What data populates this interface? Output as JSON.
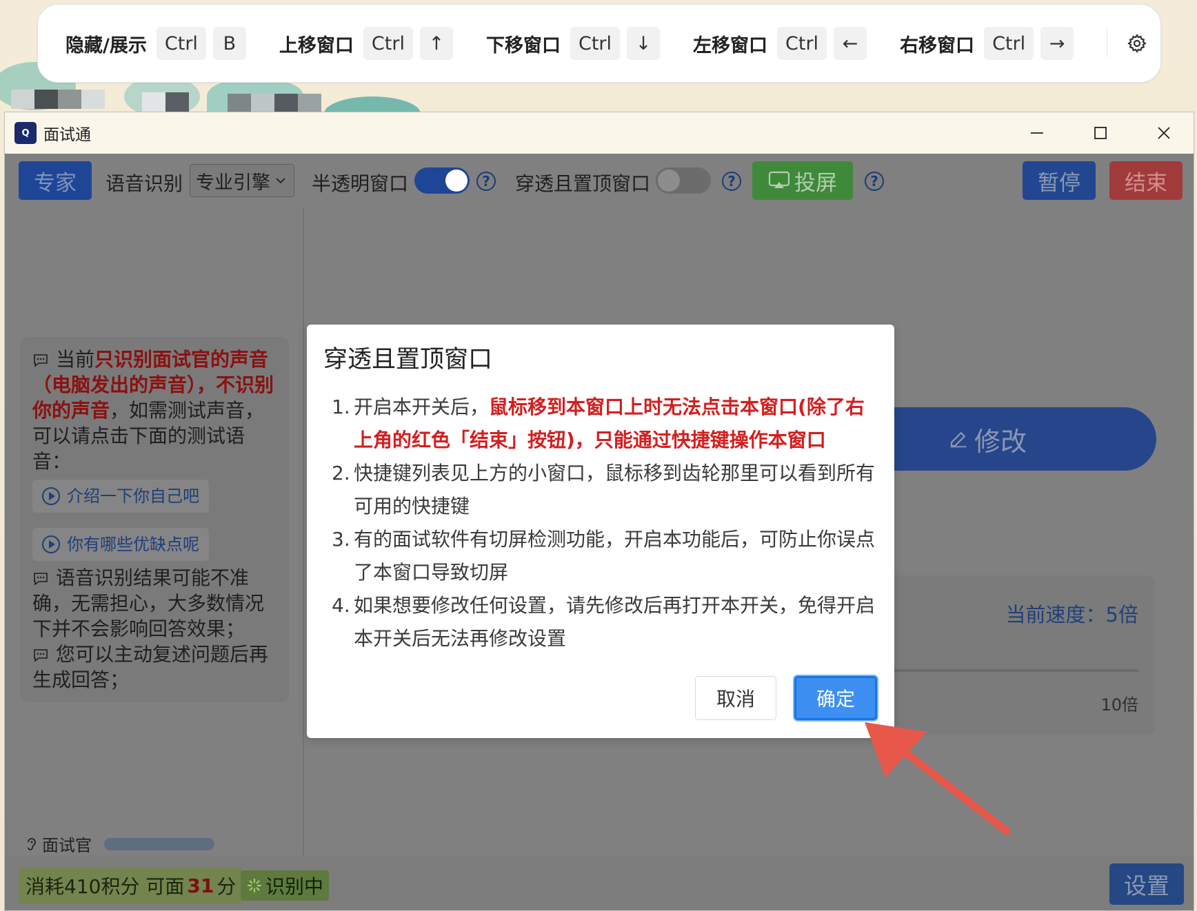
{
  "shortcuts": [
    {
      "label": "隐藏/展示",
      "keys": [
        "Ctrl",
        "B"
      ]
    },
    {
      "label": "上移窗口",
      "keys": [
        "Ctrl",
        "↑"
      ]
    },
    {
      "label": "下移窗口",
      "keys": [
        "Ctrl",
        "↓"
      ]
    },
    {
      "label": "左移窗口",
      "keys": [
        "Ctrl",
        "←"
      ]
    },
    {
      "label": "右移窗口",
      "keys": [
        "Ctrl",
        "→"
      ]
    }
  ],
  "window": {
    "title": "面试通",
    "logo_text": "Q"
  },
  "controls": {
    "expert_label": "专家",
    "speech_label": "语音识别",
    "engine_value": "专业引擎",
    "translucent_label": "半透明窗口",
    "translucent_on": true,
    "passthrough_label": "穿透且置顶窗口",
    "passthrough_on": false,
    "cast_label": "投屏",
    "pause_label": "暂停",
    "end_label": "结束",
    "colors": {
      "expert": "#1f4596",
      "cast": "#3f8a3a",
      "pause": "#224690",
      "end": "#a13b3b"
    }
  },
  "left_panel": {
    "note1_prefix": "当前",
    "note1_red": "只识别面试官的声音（电脑发出的声音），不识别你的声音",
    "note1_suffix": "，如需测试声音，可以请点击下面的测试语音：",
    "test_phrases": [
      "介绍一下你自己吧",
      "你有哪些优缺点呢"
    ],
    "note2": "语音识别结果可能不准确，无需担心，大多数情况下并不会影响回答效果；",
    "note3": "您可以主动复述问题后再生成回答；",
    "interviewer_label": "面试官"
  },
  "right_panel": {
    "edit_label": "修改",
    "speed_current": "当前速度：5倍",
    "speed_max": "10倍"
  },
  "status": {
    "points_prefix": "消耗410积分 可面",
    "points_num": "31",
    "points_suffix": "分",
    "recognizing": "识别中",
    "settings_label": "设置"
  },
  "modal": {
    "title": "穿透且置顶窗口",
    "items": [
      {
        "num": "1.",
        "text": "开启本开关后，",
        "red": "鼠标移到本窗口上时无法点击本窗口(除了右上角的红色「结束」按钮)，只能通过快捷键操作本窗口"
      },
      {
        "num": "2.",
        "text": "快捷键列表见上方的小窗口，鼠标移到齿轮那里可以看到所有可用的快捷键",
        "red": ""
      },
      {
        "num": "3.",
        "text": "有的面试软件有切屏检测功能，开启本功能后，可防止你误点了本窗口导致切屏",
        "red": ""
      },
      {
        "num": "4.",
        "text": "如果想要修改任何设置，请先修改后再打开本开关，免得开启本开关后无法再修改设置",
        "red": ""
      }
    ],
    "cancel_label": "取消",
    "confirm_label": "确定"
  }
}
